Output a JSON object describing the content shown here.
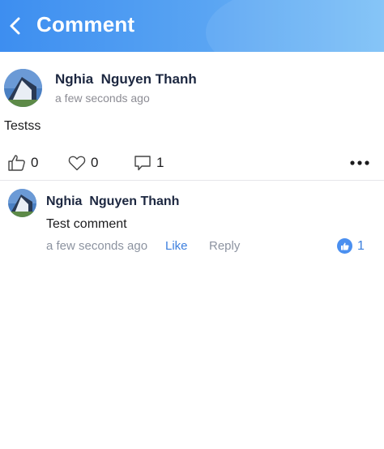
{
  "header": {
    "title": "Comment",
    "back_icon": "chevron-left-icon",
    "gradient": [
      "#3d8ef0",
      "#7cc0f7"
    ]
  },
  "post": {
    "author": "Nghia  Nguyen Thanh",
    "time": "a few seconds ago",
    "body": "Testss",
    "likes": "0",
    "hearts": "0",
    "comments": "1",
    "more_icon": "more-horizontal-icon"
  },
  "comments": [
    {
      "author": "Nghia  Nguyen Thanh",
      "text": "Test comment",
      "time": "a few seconds ago",
      "like_label": "Like",
      "reply_label": "Reply",
      "reaction_count": "1",
      "reaction_icon": "thumbs-up-badge-icon"
    }
  ],
  "colors": {
    "accent": "#3c7fde",
    "name": "#1c2740",
    "muted": "#8c93a0"
  }
}
